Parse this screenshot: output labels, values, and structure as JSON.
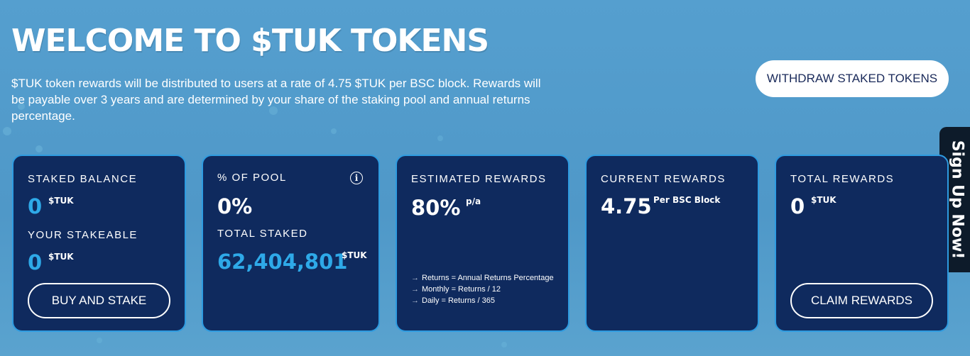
{
  "hero": {
    "title": "WELCOME TO $TUK TOKENS",
    "description": "$TUK token rewards will be distributed to users at a rate of 4.75 $TUK per BSC block. Rewards will be payable over 3 years and are determined by your share of the staking pool and annual returns percentage."
  },
  "actions": {
    "withdraw_label": "WITHDRAW STAKED TOKENS",
    "buy_stake_label": "BUY AND STAKE",
    "claim_label": "CLAIM REWARDS"
  },
  "signup": {
    "label": "Sign Up Now!"
  },
  "cards": {
    "staked": {
      "label": "STAKED BALANCE",
      "value": "0",
      "unit": "$TUK",
      "stakeable_label": "YOUR STAKEABLE",
      "stakeable_value": "0",
      "stakeable_unit": "$TUK"
    },
    "pool": {
      "label": "% OF POOL",
      "value": "0%",
      "info_glyph": "i",
      "total_label": "TOTAL STAKED",
      "total_value": "62,404,801",
      "total_unit": "$TUK"
    },
    "estimated": {
      "label": "ESTIMATED REWARDS",
      "value": "80%",
      "unit": "p/a",
      "notes": [
        "Returns = Annual Returns Percentage",
        "Monthly = Returns / 12",
        "Daily = Returns / 365"
      ]
    },
    "current": {
      "label": "CURRENT REWARDS",
      "value": "4.75",
      "unit": "Per BSC Block"
    },
    "total": {
      "label": "TOTAL REWARDS",
      "value": "0",
      "unit": "$TUK"
    }
  },
  "colors": {
    "background": "#559fcf",
    "card": "#0f2a5e",
    "card_border": "#2e9be0",
    "accent_blue": "#2ea9e8",
    "signup_tab": "#0d1b2a"
  }
}
